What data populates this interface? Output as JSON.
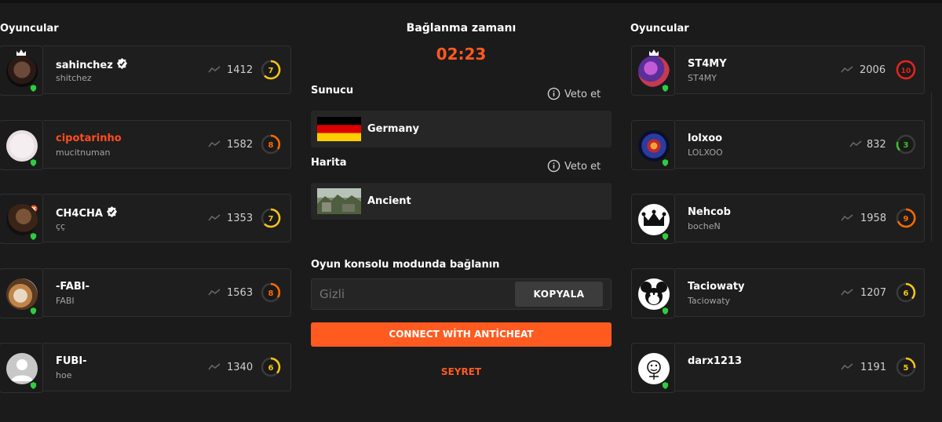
{
  "left_column_title": "Oyuncular",
  "right_column_title": "Oyuncular",
  "connection": {
    "title": "Bağlanma zamanı",
    "timer": "02:23"
  },
  "server": {
    "label": "Sunucu",
    "veto_label": "Veto et",
    "value": "Germany"
  },
  "map": {
    "label": "Harita",
    "veto_label": "Veto et",
    "value": "Ancient"
  },
  "console": {
    "label": "Oyun konsolu modunda bağlanın",
    "placeholder": "Gizli",
    "copy_label": "KOPYALA"
  },
  "connect_button": "CONNECT WİTH ANTİCHEAT",
  "watch_label": "SEYRET",
  "colors": {
    "accent": "#ff5a1f",
    "level_yellow": "#f5c518",
    "level_orange": "#ff6a00",
    "level_red": "#e8231a",
    "level_green": "#3ec12d",
    "verified": "#ffffff"
  },
  "team_left": [
    {
      "name": "sahinchez",
      "sub": "shitchez",
      "elo": "1412",
      "level": "7",
      "verified": true
    },
    {
      "name": "cipotarinho",
      "sub": "mucitnuman",
      "elo": "1582",
      "level": "8",
      "verified": false
    },
    {
      "name": "CH4CHA",
      "sub": "çç",
      "elo": "1353",
      "level": "7",
      "verified": true
    },
    {
      "name": "-FABI-",
      "sub": "FABI",
      "elo": "1563",
      "level": "8",
      "verified": false
    },
    {
      "name": "FUBI-",
      "sub": "hoe",
      "elo": "1340",
      "level": "6",
      "verified": false
    }
  ],
  "team_right": [
    {
      "name": "ST4MY",
      "sub": "ST4MY",
      "elo": "2006",
      "level": "10"
    },
    {
      "name": "lolxoo",
      "sub": "LOLXOO",
      "elo": "832",
      "level": "3"
    },
    {
      "name": "Nehcob",
      "sub": "bocheN",
      "elo": "1958",
      "level": "9"
    },
    {
      "name": "Taciowaty",
      "sub": "Taciowaty",
      "elo": "1207",
      "level": "6"
    },
    {
      "name": "darx1213",
      "sub": "",
      "elo": "1191",
      "level": "5"
    }
  ]
}
